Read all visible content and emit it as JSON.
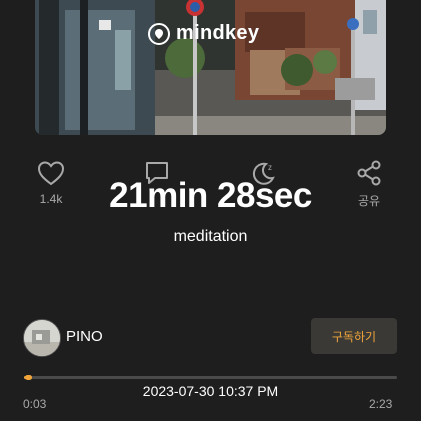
{
  "brand": {
    "name": "mindkey"
  },
  "actions": {
    "like_count": "1.4k",
    "comment_label": "",
    "sleep_label": "",
    "share_label": "공유"
  },
  "overlay": {
    "duration": "21min 28sec",
    "category": "meditation"
  },
  "author": {
    "name": "PINO"
  },
  "subscribe_label": "구독하기",
  "player": {
    "recorded_at": "2023-07-30 10:37 PM",
    "elapsed": "0:03",
    "total": "2:23",
    "progress_fraction": 0.021
  },
  "colors": {
    "accent": "#f0a53a",
    "background": "#1e1e1e",
    "muted": "#a9a9a9"
  },
  "icons": [
    "heart-icon",
    "comment-icon",
    "moon-sleep-icon",
    "share-icon",
    "mindkey-logo-icon"
  ]
}
